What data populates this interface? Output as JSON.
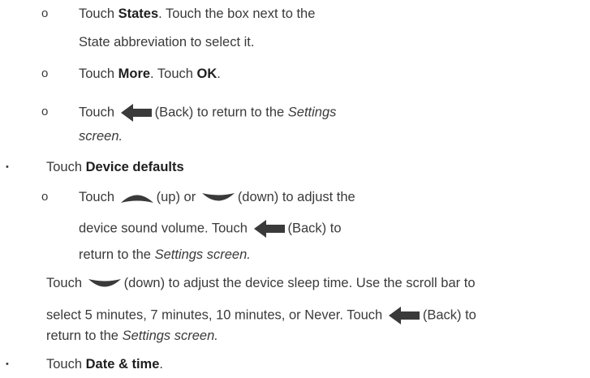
{
  "sub_marker": "o",
  "bullet_marker": "•",
  "icon_names": {
    "back": "back-arrow-icon",
    "up": "up-arrow-icon",
    "down": "down-arrow-icon"
  },
  "icon_color": "#3a3a3a",
  "block1": {
    "line1": {
      "a": "Touch ",
      "b": "States",
      "c": ". Touch the box next to the"
    },
    "line2": "State abbreviation to select it."
  },
  "block2": {
    "a": "Touch ",
    "b": "More",
    "c": ". Touch ",
    "d": "OK",
    "e": "."
  },
  "block3": {
    "line1": {
      "a": "Touch ",
      "b": "(Back) to return to the ",
      "c": "Settings"
    },
    "line2": "screen."
  },
  "block4": {
    "a": "Touch ",
    "b": "Device defaults"
  },
  "block5": {
    "line1": {
      "a": "Touch ",
      "b": "(up) or ",
      "c": "(down) to adjust the"
    },
    "line2": {
      "a": "device sound volume. Touch ",
      "b": "(Back) to"
    },
    "line3": {
      "a": "return to the ",
      "b": "Settings screen."
    }
  },
  "block6": {
    "line1": {
      "a": "Touch ",
      "b": "(down) to adjust the device sleep time. Use the scroll bar to"
    },
    "line2": {
      "a": "select 5 minutes, 7 minutes, 10 minutes, or Never. Touch ",
      "b": "(Back) to"
    },
    "line3": {
      "a": "return to the ",
      "b": "Settings screen."
    }
  },
  "block7": {
    "a": "Touch ",
    "b": "Date & time",
    "c": "."
  }
}
